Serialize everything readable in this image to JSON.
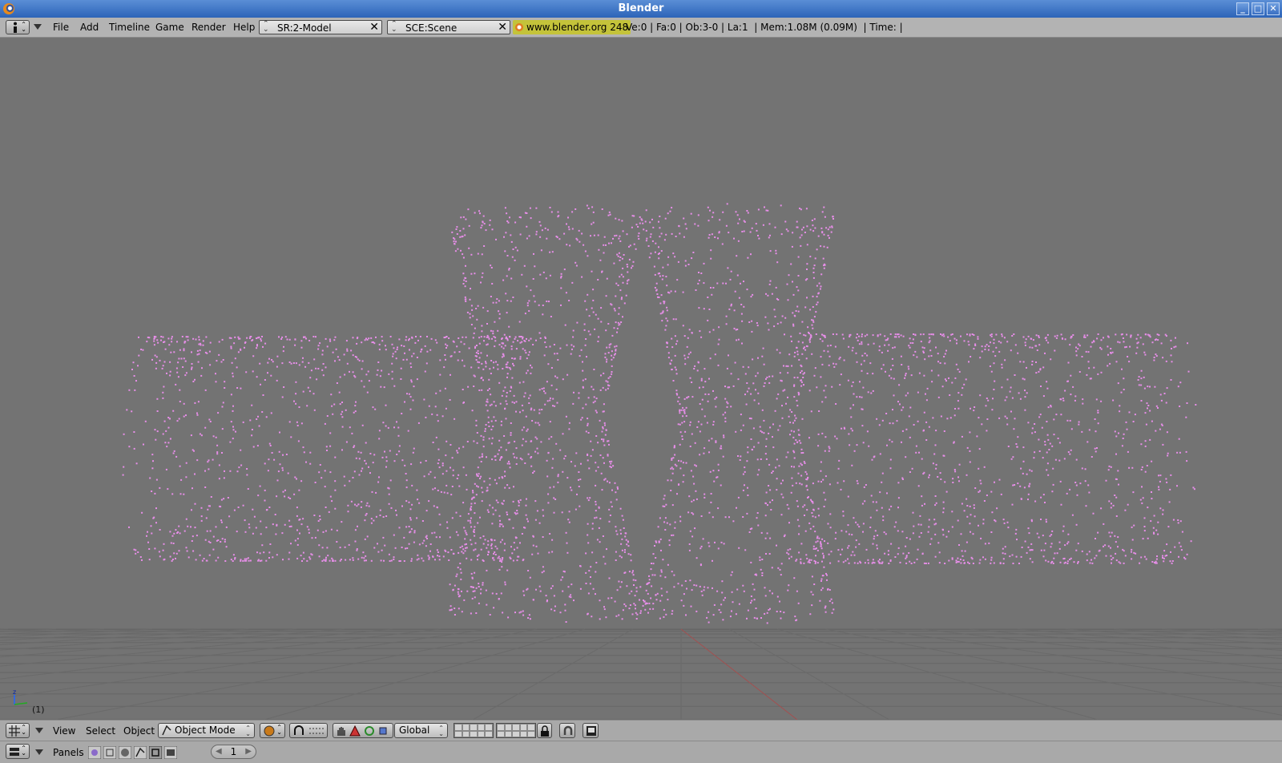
{
  "window": {
    "title": "Blender"
  },
  "info_header": {
    "menus": [
      "File",
      "Add",
      "Timeline",
      "Game",
      "Render",
      "Help"
    ],
    "screen": "SR:2-Model",
    "scene": "SCE:Scene",
    "website": "www.blender.org 248",
    "stats": "Ve:0 | Fa:0 | Ob:3-0 | La:1  | Mem:1.08M (0.09M)  | Time: |"
  },
  "viewport": {
    "frame_label": "(1)",
    "axis_labels": {
      "z": "z",
      "y": "y"
    },
    "particle_color": "#e78ee8",
    "background_color": "#737373"
  },
  "view3d_header": {
    "menus": [
      "View",
      "Select",
      "Object"
    ],
    "mode": "Object Mode",
    "orientation": "Global"
  },
  "buttons_header": {
    "panels_label": "Panels",
    "current_frame": "1"
  },
  "icons": {
    "info_editor": "info-icon",
    "view3d_editor": "grid-icon",
    "buttons_editor": "buttons-window-icon",
    "draw_type": "shaded-sphere-icon",
    "pivot": "pivot-icon",
    "manipulator": [
      "hand-icon",
      "translate-icon",
      "rotate-icon",
      "scale-icon"
    ],
    "lock": "lock-icon",
    "proportional": "magnet-icon",
    "render": "render-icon",
    "contexts": [
      "logic-icon",
      "script-icon",
      "shading-icon",
      "object-icon",
      "editing-icon",
      "scene-icon"
    ]
  }
}
